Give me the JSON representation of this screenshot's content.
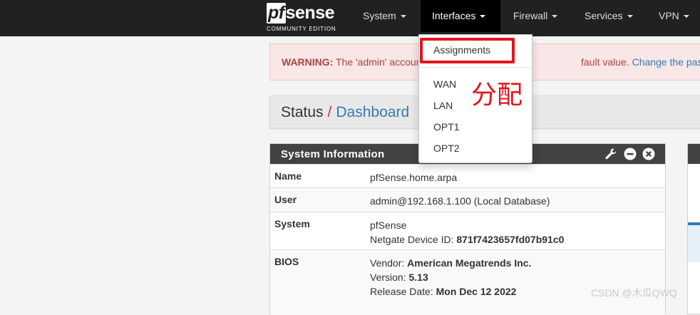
{
  "logo": {
    "main_rest": "sense",
    "main_pf": "pf",
    "sub": "COMMUNITY EDITION"
  },
  "nav": {
    "items": [
      {
        "label": "System"
      },
      {
        "label": "Interfaces"
      },
      {
        "label": "Firewall"
      },
      {
        "label": "Services"
      },
      {
        "label": "VPN"
      }
    ]
  },
  "alert": {
    "label": "WARNING:",
    "text_left": "The 'admin' accoun",
    "text_mid": "fault value.",
    "link": "Change the password in th"
  },
  "breadcrumb": {
    "section": "Status",
    "separator": "/",
    "page": "Dashboard"
  },
  "panel": {
    "title": "System Information",
    "rows": [
      {
        "key": "Name",
        "lines": [
          "pfSense.home.arpa"
        ]
      },
      {
        "key": "User",
        "lines": [
          "admin@192.168.1.100 (Local Database)"
        ]
      },
      {
        "key": "System",
        "line1": "pfSense",
        "line2_label": "Netgate Device ID: ",
        "line2_value": "871f7423657fd07b91c0"
      },
      {
        "key": "BIOS",
        "vendor_label": "Vendor: ",
        "vendor": "American Megatrends Inc.",
        "version_label": "Version: ",
        "version": "5.13",
        "release_label": "Release Date: ",
        "release": "Mon Dec 12 2022"
      }
    ]
  },
  "dropdown": {
    "items": [
      {
        "label": "Assignments"
      },
      {
        "label": "WAN"
      },
      {
        "label": "LAN"
      },
      {
        "label": "OPT1"
      },
      {
        "label": "OPT2"
      }
    ]
  },
  "annotation": {
    "text": "分配",
    "color": "#e5141b"
  },
  "watermark": "CSDN @木瓜QWQ",
  "colors": {
    "navbar": "#212121",
    "link": "#337ab7",
    "warning": "#a94442",
    "highlight": "#e5141b"
  },
  "icons": [
    "wrench-icon",
    "minus-circle-icon",
    "close-circle-icon"
  ]
}
